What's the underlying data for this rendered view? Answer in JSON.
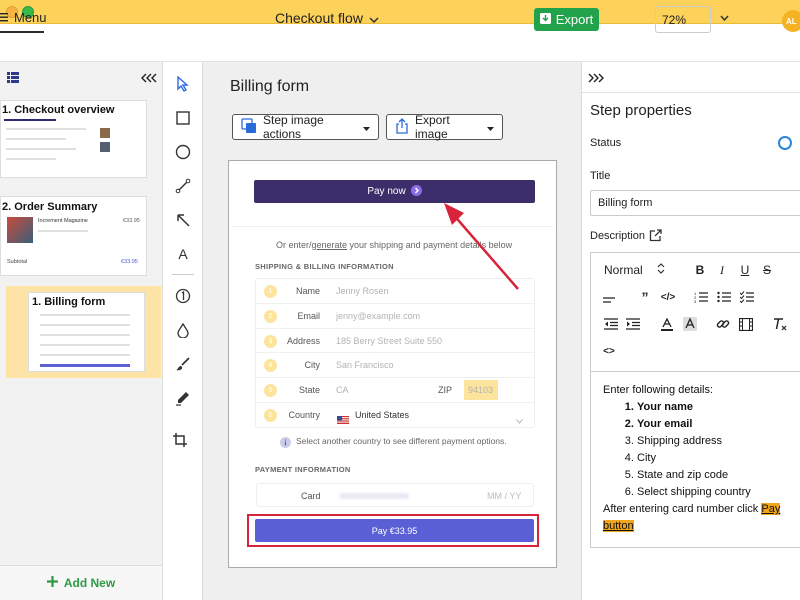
{
  "topbar": {
    "menu_label": "Menu",
    "doc_title": "Checkout flow",
    "export_label": "Export",
    "zoom": "72%",
    "avatar_initials": "AL"
  },
  "left_panel": {
    "steps": [
      {
        "label": "1. Checkout overview"
      },
      {
        "label": "2. Order Summary",
        "thumb_item": "Increment Magazine",
        "thumb_price": "€33.95",
        "thumb_subtotal": "Subtotal"
      },
      {
        "label": "1. Billing form"
      }
    ],
    "add_new_label": "Add New"
  },
  "canvas": {
    "title": "Billing form",
    "step_image_actions_label": "Step image actions",
    "export_image_label": "Export image",
    "form": {
      "pay_now_label": "Pay now",
      "or_text_prefix": "Or enter/",
      "or_text_link": "generate",
      "or_text_suffix": " your shipping and payment details below",
      "shipping_heading": "SHIPPING & BILLING INFORMATION",
      "fields": [
        {
          "num": "1",
          "label": "Name",
          "value": "Jenny Rosen"
        },
        {
          "num": "2",
          "label": "Email",
          "value": "jenny@example.com"
        },
        {
          "num": "3",
          "label": "Address",
          "value": "185 Berry Street Suite 550"
        },
        {
          "num": "4",
          "label": "City",
          "value": "San Francisco"
        },
        {
          "num": "5",
          "label": "State",
          "value": "CA",
          "zip_label": "ZIP",
          "zip_value": "94103"
        },
        {
          "num": "6",
          "label": "Country",
          "value": "United States"
        }
      ],
      "country_hint": "Select another country to see different payment options.",
      "payment_heading": "PAYMENT INFORMATION",
      "card_label": "Card",
      "card_placeholder": "MM / YY",
      "pay_label": "Pay €33.95"
    }
  },
  "right_panel": {
    "title": "Step properties",
    "status_label": "Status",
    "title_label": "Title",
    "title_value": "Billing form",
    "description_label": "Description",
    "format_select": "Normal",
    "content": {
      "intro": "Enter following details:",
      "items": [
        "Your name",
        "Your email",
        "Shipping address",
        "City",
        "State and zip code",
        "Select shipping country"
      ],
      "bold_items": [
        true,
        true,
        false,
        false,
        false,
        false
      ],
      "after_prefix": "After entering card number click ",
      "after_highlight": "Pay button"
    }
  },
  "colors": {
    "titlebar": "#fcd25a",
    "export_green": "#22a24a",
    "pay_button": "#5b5fd6",
    "pay_now": "#3b2e6b",
    "annotation_red": "#d8243a",
    "highlight": "#f0a51c"
  }
}
